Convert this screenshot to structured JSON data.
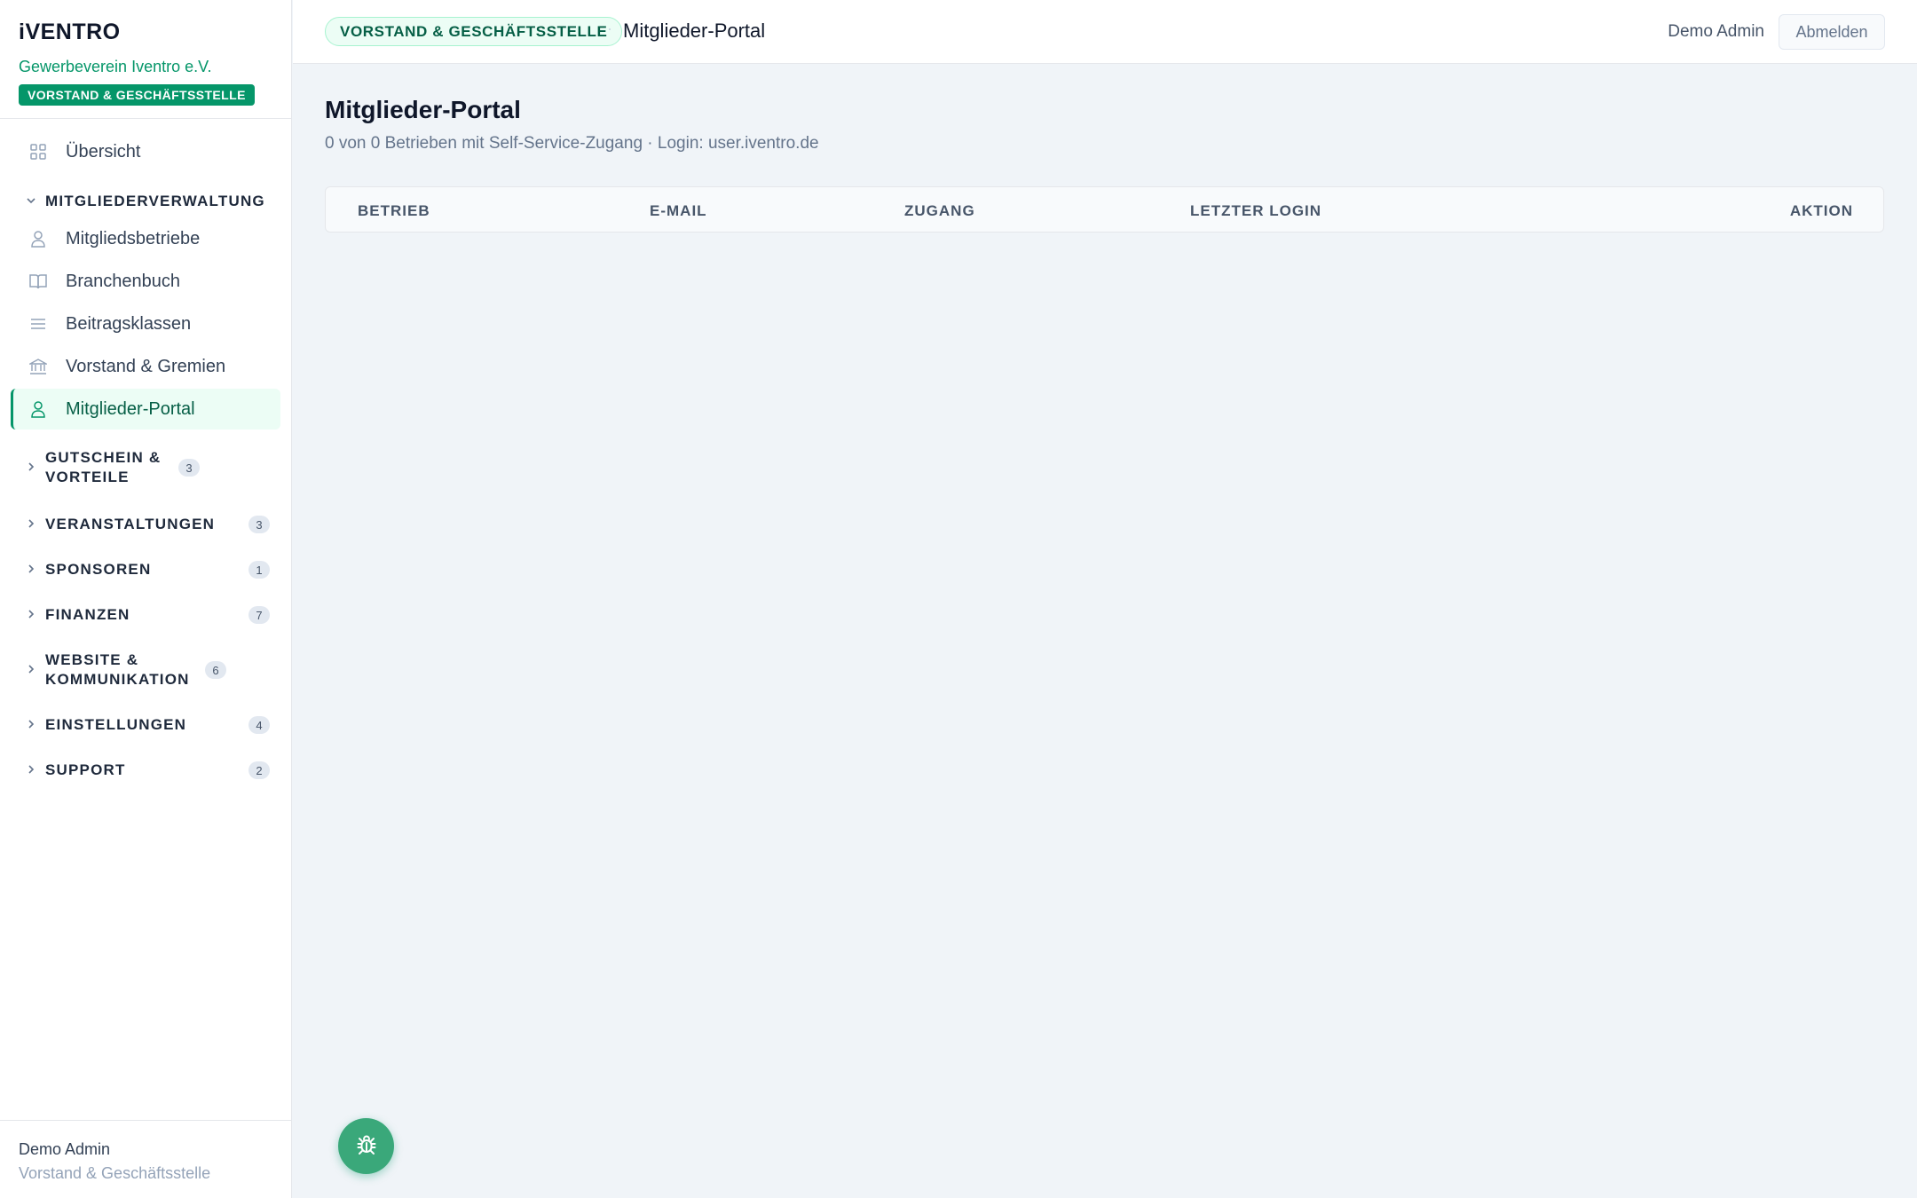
{
  "brand": {
    "logo": "iVENTRO",
    "org": "Gewerbeverein Iventro e.V.",
    "role_badge": "VORSTAND & GESCHÄFTSSTELLE"
  },
  "sidebar": {
    "overview": {
      "label": "Übersicht",
      "icon": "grid-icon"
    },
    "group_open": {
      "label": "MITGLIEDERVERWALTUNG"
    },
    "items": [
      {
        "label": "Mitgliedsbetriebe",
        "icon": "user-icon"
      },
      {
        "label": "Branchenbuch",
        "icon": "book-icon"
      },
      {
        "label": "Beitragsklassen",
        "icon": "list-icon"
      },
      {
        "label": "Vorstand & Gremien",
        "icon": "bank-icon"
      },
      {
        "label": "Mitglieder-Portal",
        "icon": "user-icon",
        "active": true
      }
    ],
    "groups": [
      {
        "label": "GUTSCHEIN & VORTEILE",
        "count": "3"
      },
      {
        "label": "VERANSTALTUNGEN",
        "count": "3"
      },
      {
        "label": "SPONSOREN",
        "count": "1"
      },
      {
        "label": "FINANZEN",
        "count": "7"
      },
      {
        "label": "WEBSITE & KOMMUNIKATION",
        "count": "6"
      },
      {
        "label": "EINSTELLUNGEN",
        "count": "4"
      },
      {
        "label": "SUPPORT",
        "count": "2"
      }
    ],
    "footer": {
      "name": "Demo Admin",
      "role": "Vorstand & Geschäftsstelle"
    }
  },
  "topbar": {
    "breadcrumb_badge": "VORSTAND & GESCHÄFTSSTELLE",
    "separator": "·",
    "title": "Mitglieder-Portal",
    "user": "Demo Admin",
    "logout_label": "Abmelden"
  },
  "main": {
    "title": "Mitglieder-Portal",
    "subtitle": "0 von 0 Betrieben mit Self-Service-Zugang · Login: user.iventro.de",
    "table_headers": [
      "BETRIEB",
      "E-MAIL",
      "ZUGANG",
      "LETZTER LOGIN",
      "AKTION"
    ]
  },
  "colors": {
    "accent": "#059669",
    "fab": "#3aa87a"
  },
  "fab": {
    "icon": "bug-icon"
  }
}
